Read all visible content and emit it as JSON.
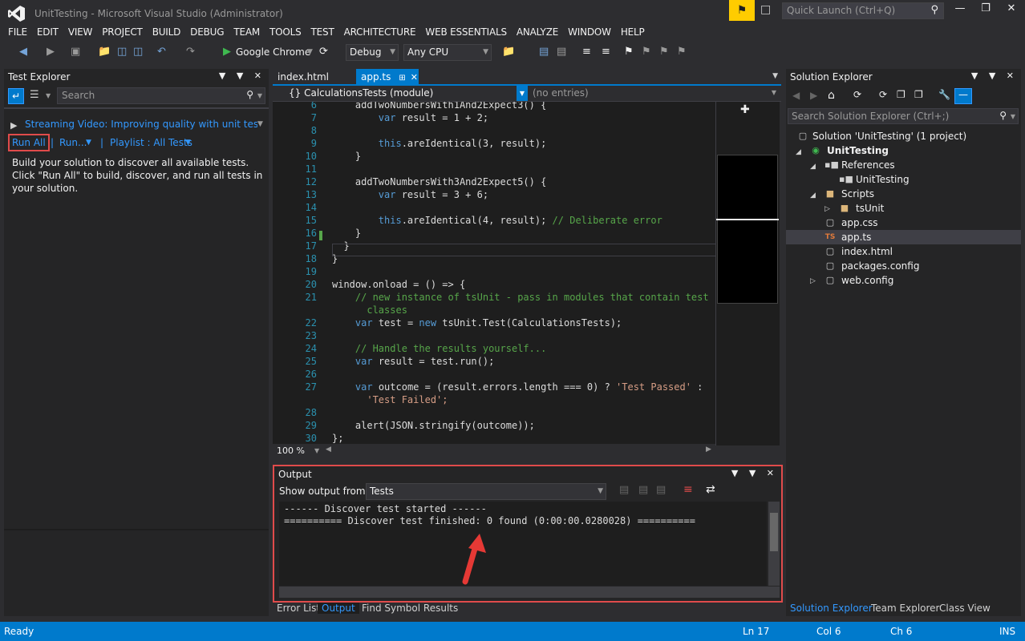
{
  "window": {
    "title": "UnitTesting - Microsoft Visual Studio (Administrator)",
    "quick_launch_placeholder": "Quick Launch (Ctrl+Q)"
  },
  "menu": [
    "FILE",
    "EDIT",
    "VIEW",
    "PROJECT",
    "BUILD",
    "DEBUG",
    "TEAM",
    "TOOLS",
    "TEST",
    "ARCHITECTURE",
    "WEB ESSENTIALS",
    "ANALYZE",
    "WINDOW",
    "HELP"
  ],
  "toolbar": {
    "browser_label": "Google Chrome",
    "config": "Debug",
    "platform": "Any CPU"
  },
  "test_explorer": {
    "title": "Test Explorer",
    "search_placeholder": "Search",
    "video_link": "Streaming Video: Improving quality with unit tests anc",
    "run_all": "Run All",
    "run": "Run...",
    "playlist": "Playlist : All Tests",
    "message": "Build your solution to discover all available tests. Click \"Run All\" to build, discover, and run all tests in your solution."
  },
  "editor": {
    "tabs": [
      "index.html",
      "app.ts"
    ],
    "nav_left": "{} CalculationsTests (module)",
    "nav_right": "(no entries)",
    "zoom": "100 %",
    "lines": [
      {
        "n": "6",
        "t": "    addTwoNumbersWith1And2Expect3() {"
      },
      {
        "n": "7",
        "t": "        var result = 1 + 2;"
      },
      {
        "n": "8",
        "t": ""
      },
      {
        "n": "9",
        "t": "        this.areIdentical(3, result);"
      },
      {
        "n": "10",
        "t": "    }"
      },
      {
        "n": "11",
        "t": ""
      },
      {
        "n": "12",
        "t": "    addTwoNumbersWith3And2Expect5() {"
      },
      {
        "n": "13",
        "t": "        var result = 3 + 6;"
      },
      {
        "n": "14",
        "t": ""
      },
      {
        "n": "15",
        "t": "        this.areIdentical(4, result); // Deliberate error"
      },
      {
        "n": "16",
        "t": "    }"
      },
      {
        "n": "17",
        "t": "  }"
      },
      {
        "n": "18",
        "t": "}"
      },
      {
        "n": "19",
        "t": ""
      },
      {
        "n": "20",
        "t": "window.onload = () => {"
      },
      {
        "n": "21",
        "t": "    // new instance of tsUnit - pass in modules that contain test"
      },
      {
        "n": "",
        "t": "      classes"
      },
      {
        "n": "22",
        "t": "    var test = new tsUnit.Test(CalculationsTests);"
      },
      {
        "n": "23",
        "t": ""
      },
      {
        "n": "24",
        "t": "    // Handle the results yourself..."
      },
      {
        "n": "25",
        "t": "    var result = test.run();"
      },
      {
        "n": "26",
        "t": ""
      },
      {
        "n": "27",
        "t": "    var outcome = (result.errors.length === 0) ? 'Test Passed' :"
      },
      {
        "n": "",
        "t": "      'Test Failed';"
      },
      {
        "n": "28",
        "t": ""
      },
      {
        "n": "29",
        "t": "    alert(JSON.stringify(outcome));"
      },
      {
        "n": "30",
        "t": "};"
      }
    ]
  },
  "output": {
    "title": "Output",
    "show_from_label": "Show output from:",
    "source": "Tests",
    "line1": "------ Discover test started ------",
    "line2": "========== Discover test finished: 0 found (0:00:00.0280028) =========="
  },
  "bottom_tabs": [
    "Error List",
    "Output",
    "Find Symbol Results"
  ],
  "solution_explorer": {
    "title": "Solution Explorer",
    "search_placeholder": "Search Solution Explorer (Ctrl+;)",
    "items": [
      "Solution 'UnitTesting' (1 project)",
      "UnitTesting",
      "References",
      "UnitTesting",
      "Scripts",
      "tsUnit",
      "app.css",
      "app.ts",
      "index.html",
      "packages.config",
      "web.config"
    ],
    "tabs": [
      "Solution Explorer",
      "Team Explorer",
      "Class View"
    ]
  },
  "status": {
    "ready": "Ready",
    "ln": "Ln 17",
    "col": "Col 6",
    "ch": "Ch 6",
    "mode": "INS"
  },
  "colors": {
    "accent": "#007acc",
    "highlight": "#e04b4b",
    "notify": "#ffcc00"
  }
}
